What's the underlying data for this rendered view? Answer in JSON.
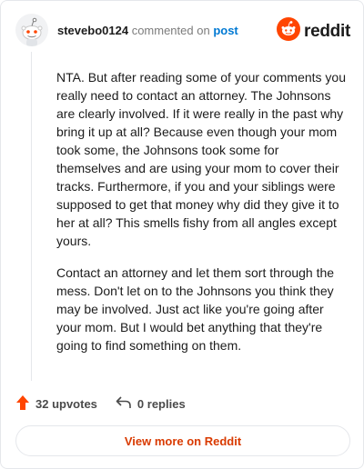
{
  "header": {
    "author": "stevebo0124",
    "action_text": "commented on",
    "post_link": "post",
    "brand": "reddit"
  },
  "comment": {
    "paragraphs": [
      "NTA. But after reading some of your comments you really need to contact an attorney. The Johnsons are clearly involved. If it were really in the past why bring it up at all? Because even though your mom took some, the Johnsons took some for themselves and are using your mom to cover their tracks. Furthermore, if you and your siblings were supposed to get that money why did they give it to her at all? This smells fishy from all angles except yours.",
      "Contact an attorney and let them sort through the mess. Don't let on to the Johnsons you think they may be involved. Just act like you're going after your mom. But I would bet anything that they're going to find something on them."
    ]
  },
  "footer": {
    "upvotes": "32 upvotes",
    "replies": "0 replies"
  },
  "cta": {
    "view_more": "View more on Reddit"
  },
  "colors": {
    "accent": "#d93a00",
    "reddit_orange": "#ff4500",
    "link": "#0079d3"
  },
  "icons": [
    "snoo-avatar-icon",
    "reddit-logo-icon",
    "upvote-arrow-icon",
    "reply-arrow-icon"
  ]
}
